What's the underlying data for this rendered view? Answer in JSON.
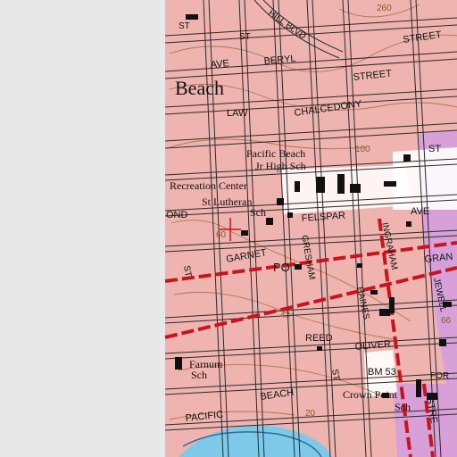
{
  "colors": {
    "background_blank": "#e8e8e8",
    "urban_tint": "#f0b4b0",
    "park_tint": "#ffffff",
    "school_tint": "#d8a0d8",
    "road_major": "#c8141e",
    "road_minor": "#2a2a2a",
    "contour": "#b0764a",
    "water": "#7ec8e8",
    "building": "#111111"
  },
  "labels": {
    "place_beach": "Beach",
    "street_st_top": "ST",
    "street_st_top2": "ST",
    "street_hill_blvd": "HILL BLVD",
    "street_street_top": "STREET",
    "street_ave_beryl_1": "AVE",
    "street_beryl": "BERYL",
    "street_street_2": "STREET",
    "street_law": "LAW",
    "street_chalcedony": "CHALCEDONY",
    "school_pacific_beach_1": "Pacific Beach",
    "school_pacific_beach_2": "Jr High Sch",
    "recreation_center": "Recreation Center",
    "school_st_lutheran_1": "St Lutheran",
    "school_st_lutheran_2": "Sch",
    "street_felspar": "FELSPAR",
    "street_ave_felspar": "AVE",
    "street_ond": "OND",
    "street_garnet": "GARNET",
    "street_gresham": "GRESHAM",
    "street_ingraham": "INGRAHAM",
    "street_gran": "GRAN",
    "street_st_left": "ST",
    "street_po": "PO",
    "street_haines": "HAINES",
    "street_jewell": "JEWELL",
    "street_reed": "REED",
    "street_oliver": "OLIVER",
    "benchmark": "BM 53",
    "school_farnum_1": "Farnum",
    "school_farnum_2": "Sch",
    "street_st_bottom": "ST",
    "street_beach": "BEACH",
    "school_crown_point_1": "Crown Point",
    "school_crown_point_2": "Sch",
    "street_pacific": "PACIFIC",
    "street_stre": "STRE",
    "street_for": "FOR",
    "street_st_right": "ST",
    "contour_260": "260",
    "contour_100": "100",
    "contour_60": "60",
    "contour_43": "43",
    "contour_66": "66",
    "contour_20": "20"
  }
}
